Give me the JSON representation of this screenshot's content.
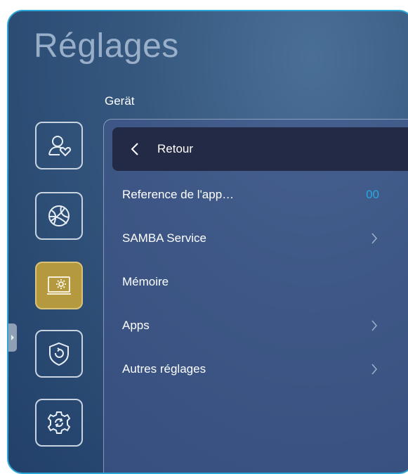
{
  "page": {
    "title": "Réglages",
    "section": "Gerät"
  },
  "sidebar": {
    "items": [
      {
        "name": "user-settings",
        "icon": "user-heart-icon",
        "active": false
      },
      {
        "name": "network",
        "icon": "globe-icon",
        "active": false
      },
      {
        "name": "device",
        "icon": "device-settings-icon",
        "active": true
      },
      {
        "name": "security",
        "icon": "shield-icon",
        "active": false
      },
      {
        "name": "system",
        "icon": "gear-refresh-icon",
        "active": false
      }
    ],
    "active_color": "#b4993f"
  },
  "panel": {
    "back_label": "Retour",
    "items": [
      {
        "label": "Reference de l'app…",
        "value": "00"
      },
      {
        "label": "SAMBA Service",
        "arrow": true
      },
      {
        "label": "Mémoire"
      },
      {
        "label": "Apps",
        "arrow": true
      },
      {
        "label": "Autres réglages",
        "arrow": true
      }
    ]
  },
  "colors": {
    "accent": "#2aa7e0",
    "frame": "#2aa7d6"
  }
}
